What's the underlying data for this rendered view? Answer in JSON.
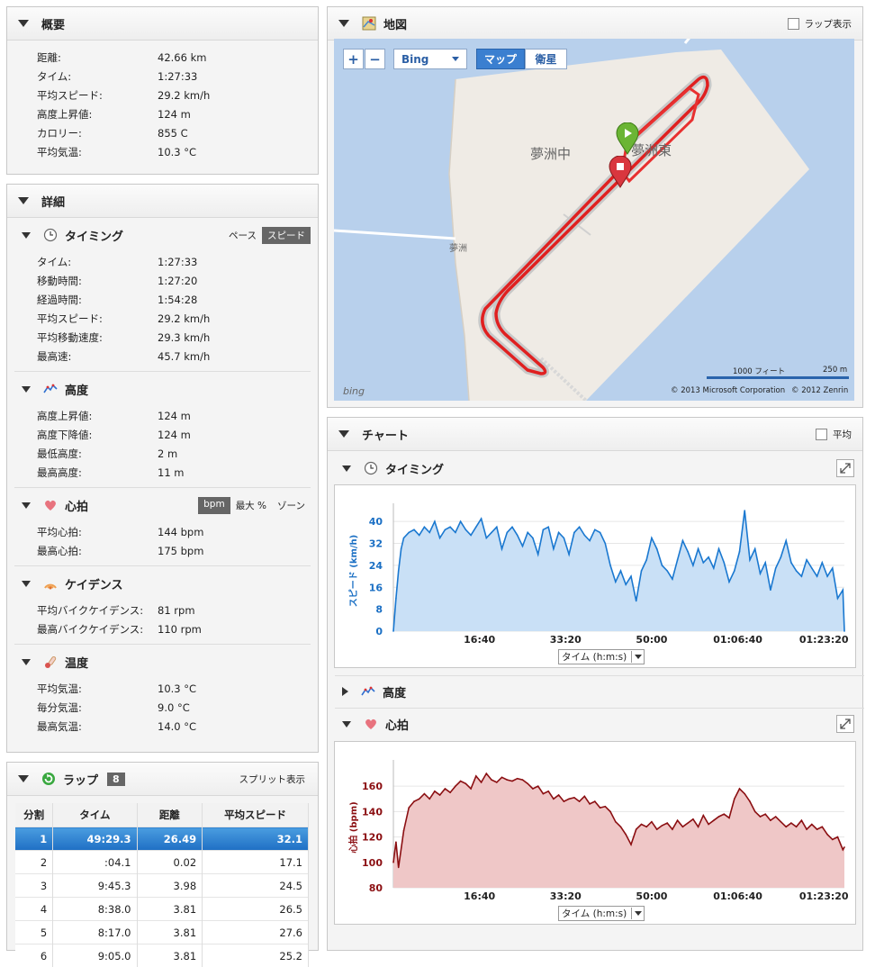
{
  "summary": {
    "title": "概要",
    "rows": [
      {
        "label": "距離:",
        "value": "42.66 km"
      },
      {
        "label": "タイム:",
        "value": "1:27:33"
      },
      {
        "label": "平均スピード:",
        "value": "29.2 km/h"
      },
      {
        "label": "高度上昇値:",
        "value": "124 m"
      },
      {
        "label": "カロリー:",
        "value": "855 C"
      },
      {
        "label": "平均気温:",
        "value": "10.3 °C"
      }
    ]
  },
  "details": {
    "title": "詳細",
    "timing": {
      "title": "タイミング",
      "toggle": [
        "ペース",
        "スピード"
      ],
      "rows": [
        {
          "label": "タイム:",
          "value": "1:27:33"
        },
        {
          "label": "移動時間:",
          "value": "1:27:20"
        },
        {
          "label": "経過時間:",
          "value": "1:54:28"
        },
        {
          "label": "平均スピード:",
          "value": "29.2 km/h"
        },
        {
          "label": "平均移動速度:",
          "value": "29.3 km/h"
        },
        {
          "label": "最高速:",
          "value": "45.7 km/h"
        }
      ]
    },
    "elevation": {
      "title": "高度",
      "rows": [
        {
          "label": "高度上昇値:",
          "value": "124 m"
        },
        {
          "label": "高度下降値:",
          "value": "124 m"
        },
        {
          "label": "最低高度:",
          "value": "2 m"
        },
        {
          "label": "最高高度:",
          "value": "11 m"
        }
      ]
    },
    "heart": {
      "title": "心拍",
      "toggle": [
        "bpm",
        "最大 %",
        "ゾーン"
      ],
      "rows": [
        {
          "label": "平均心拍:",
          "value": "144 bpm"
        },
        {
          "label": "最高心拍:",
          "value": "175 bpm"
        }
      ]
    },
    "cadence": {
      "title": "ケイデンス",
      "rows": [
        {
          "label": "平均バイクケイデンス:",
          "value": "81 rpm"
        },
        {
          "label": "最高バイクケイデンス:",
          "value": "110 rpm"
        }
      ]
    },
    "temperature": {
      "title": "温度",
      "rows": [
        {
          "label": "平均気温:",
          "value": "10.3 °C"
        },
        {
          "label": "毎分気温:",
          "value": "9.0 °C"
        },
        {
          "label": "最高気温:",
          "value": "14.0 °C"
        }
      ]
    }
  },
  "laps": {
    "title": "ラップ",
    "count": "8",
    "split_link": "スプリット表示",
    "columns": [
      "分割",
      "タイム",
      "距離",
      "平均スピード"
    ],
    "rows": [
      [
        "1",
        "49:29.3",
        "26.49",
        "32.1"
      ],
      [
        "2",
        ":04.1",
        "0.02",
        "17.1"
      ],
      [
        "3",
        "9:45.3",
        "3.98",
        "24.5"
      ],
      [
        "4",
        "8:38.0",
        "3.81",
        "26.5"
      ],
      [
        "5",
        "8:17.0",
        "3.81",
        "27.6"
      ],
      [
        "6",
        "9:05.0",
        "3.81",
        "25.2"
      ]
    ]
  },
  "map": {
    "title": "地図",
    "lap_toggle": "ラップ表示",
    "zoom_in": "+",
    "zoom_out": "−",
    "provider": "Bing",
    "modes": [
      "マップ",
      "衛星"
    ],
    "labels": [
      "夢洲中",
      "夢洲東",
      "夢洲"
    ],
    "scale_ft": "1000 フィート",
    "scale_m": "250 m",
    "copyright_ms": "© 2013 Microsoft Corporation",
    "copyright_zenrin": "© 2012 Zenrin",
    "bing_logo": "bing"
  },
  "charts": {
    "title": "チャート",
    "avg_toggle": "平均",
    "timing_title": "タイミング",
    "elevation_title": "高度",
    "heart_title": "心拍",
    "axis_selector": "タイム (h:m:s)"
  },
  "chart_data": [
    {
      "type": "area",
      "ylabel": "スピード (km/h)",
      "xlabel": "タイム (h:m:s)",
      "ylim": [
        0,
        44
      ],
      "yticks": [
        0,
        8,
        16,
        24,
        32,
        40
      ],
      "xticks": [
        "16:40",
        "33:20",
        "50:00",
        "01:06:40",
        "01:23:20"
      ],
      "x_minutes": [
        0,
        0.5,
        1,
        1.5,
        2,
        3,
        4,
        5,
        6,
        7,
        8,
        9,
        10,
        11,
        12,
        13,
        14,
        15,
        16,
        17,
        18,
        19,
        20,
        21,
        22,
        23,
        24,
        25,
        26,
        27,
        28,
        29,
        30,
        31,
        32,
        33,
        34,
        35,
        36,
        37,
        38,
        39,
        40,
        41,
        42,
        43,
        44,
        45,
        46,
        47,
        48,
        49,
        50,
        51,
        52,
        53,
        54,
        55,
        56,
        57,
        58,
        59,
        60,
        61,
        62,
        63,
        64,
        65,
        66,
        67,
        68,
        69,
        70,
        71,
        72,
        73,
        74,
        75,
        76,
        77,
        78,
        79,
        80,
        81,
        82,
        83,
        84,
        85,
        86,
        87,
        87.3
      ],
      "values": [
        0,
        12,
        22,
        30,
        34,
        36,
        37,
        35,
        38,
        36,
        40,
        34,
        37,
        38,
        36,
        40,
        37,
        35,
        38,
        41,
        34,
        36,
        38,
        30,
        36,
        38,
        35,
        31,
        36,
        34,
        28,
        37,
        38,
        30,
        36,
        34,
        28,
        36,
        38,
        35,
        33,
        37,
        36,
        32,
        24,
        18,
        22,
        17,
        20,
        11,
        22,
        26,
        34,
        30,
        24,
        22,
        19,
        26,
        33,
        29,
        24,
        30,
        25,
        27,
        23,
        30,
        25,
        18,
        22,
        29,
        44,
        26,
        30,
        21,
        25,
        15,
        23,
        27,
        33,
        25,
        22,
        20,
        26,
        23,
        20,
        25,
        20,
        23,
        12,
        15,
        0
      ]
    },
    {
      "type": "area",
      "ylabel": "心拍 (bpm)",
      "xlabel": "タイム (h:m:s)",
      "ylim": [
        80,
        175
      ],
      "yticks": [
        80,
        100,
        120,
        140,
        160
      ],
      "xticks": [
        "16:40",
        "33:20",
        "50:00",
        "01:06:40",
        "01:23:20"
      ],
      "x_minutes": [
        0,
        0.5,
        1,
        2,
        3,
        4,
        5,
        6,
        7,
        8,
        9,
        10,
        11,
        12,
        13,
        14,
        15,
        16,
        17,
        18,
        19,
        20,
        21,
        22,
        23,
        24,
        25,
        26,
        27,
        28,
        29,
        30,
        31,
        32,
        33,
        34,
        35,
        36,
        37,
        38,
        39,
        40,
        41,
        42,
        43,
        44,
        45,
        46,
        47,
        48,
        49,
        50,
        51,
        52,
        53,
        54,
        55,
        56,
        57,
        58,
        59,
        60,
        61,
        62,
        63,
        64,
        65,
        66,
        67,
        68,
        69,
        70,
        71,
        72,
        73,
        74,
        75,
        76,
        77,
        78,
        79,
        80,
        81,
        82,
        83,
        84,
        85,
        86,
        87,
        87.3
      ],
      "values": [
        100,
        116,
        96,
        125,
        143,
        148,
        150,
        154,
        150,
        156,
        153,
        158,
        155,
        160,
        164,
        162,
        158,
        168,
        163,
        170,
        165,
        163,
        167,
        165,
        164,
        166,
        165,
        162,
        158,
        160,
        154,
        156,
        150,
        153,
        148,
        150,
        151,
        148,
        152,
        146,
        148,
        143,
        144,
        140,
        132,
        128,
        122,
        114,
        126,
        130,
        128,
        132,
        126,
        129,
        131,
        126,
        133,
        128,
        131,
        134,
        128,
        137,
        130,
        133,
        136,
        138,
        135,
        150,
        158,
        154,
        148,
        140,
        136,
        138,
        133,
        136,
        132,
        128,
        131,
        128,
        133,
        126,
        130,
        126,
        128,
        122,
        118,
        120,
        110,
        112
      ]
    }
  ]
}
